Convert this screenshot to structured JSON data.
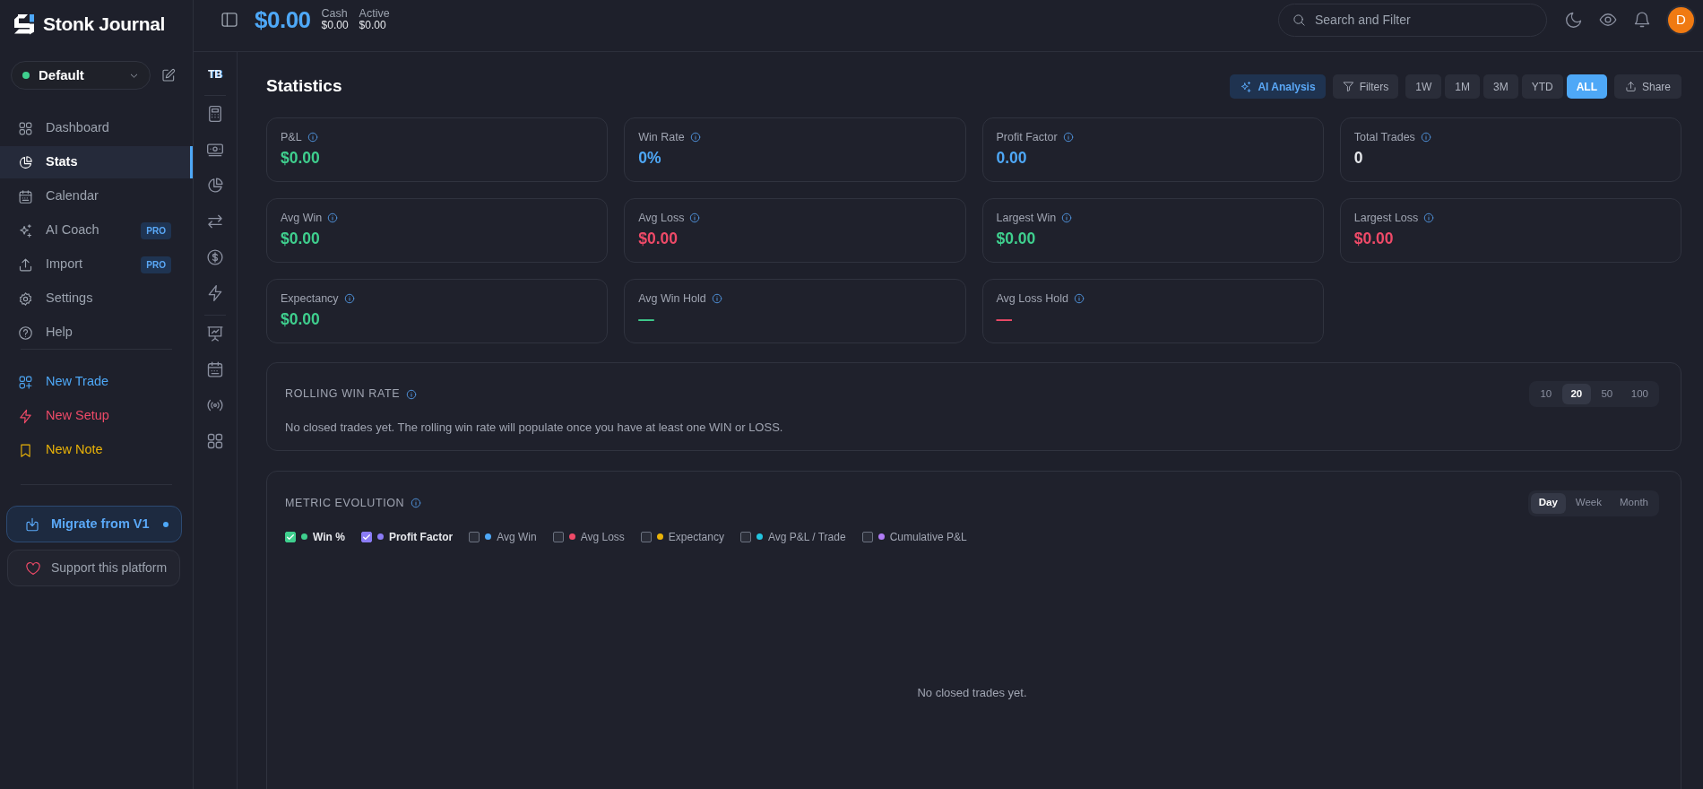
{
  "sidebar": {
    "brand": "Stonk Journal",
    "profile": {
      "name": "Default"
    },
    "nav": [
      {
        "label": "Dashboard",
        "selected": false
      },
      {
        "label": "Stats",
        "selected": true
      },
      {
        "label": "Calendar",
        "selected": false
      },
      {
        "label": "AI Coach",
        "selected": false,
        "badge": "PRO"
      },
      {
        "label": "Import",
        "selected": false,
        "badge": "PRO"
      },
      {
        "label": "Settings",
        "selected": false
      },
      {
        "label": "Help",
        "selected": false
      }
    ],
    "actions": [
      {
        "label": "New Trade",
        "color": "#4ea8f7"
      },
      {
        "label": "New Setup",
        "color": "#ef4a68"
      },
      {
        "label": "New Note",
        "color": "#eab308"
      }
    ],
    "migrate_button": "Migrate from V1",
    "support_button": "Support this platform"
  },
  "rail": {
    "initials": "TB"
  },
  "top_bar": {
    "balance": "$0.00",
    "accounts": [
      {
        "label": "Cash",
        "value": "$0.00"
      },
      {
        "label": "Active",
        "value": "$0.00"
      }
    ],
    "search": {
      "placeholder": "Search and Filter"
    },
    "avatar": {
      "initial": "D"
    }
  },
  "page": {
    "title": "Statistics",
    "ai_button": "AI Analysis",
    "filters_button": "Filters",
    "ranges": [
      {
        "label": "1W",
        "selected": false
      },
      {
        "label": "1M",
        "selected": false
      },
      {
        "label": "3M",
        "selected": false
      },
      {
        "label": "YTD",
        "selected": false
      },
      {
        "label": "ALL",
        "selected": true
      }
    ],
    "share_button": "Share"
  },
  "metrics": [
    {
      "label": "P&L",
      "value": "$0.00",
      "color": "#3fcf8e"
    },
    {
      "label": "Win Rate",
      "value": "0%",
      "color": "#4ea8f7"
    },
    {
      "label": "Profit Factor",
      "value": "0.00",
      "color": "#4ea8f7"
    },
    {
      "label": "Total Trades",
      "value": "0",
      "color": "#e5e7eb"
    },
    {
      "label": "Avg Win",
      "value": "$0.00",
      "color": "#3fcf8e"
    },
    {
      "label": "Avg Loss",
      "value": "$0.00",
      "color": "#ef4a68"
    },
    {
      "label": "Largest Win",
      "value": "$0.00",
      "color": "#3fcf8e"
    },
    {
      "label": "Largest Loss",
      "value": "$0.00",
      "color": "#ef4a68"
    },
    {
      "label": "Expectancy",
      "value": "$0.00",
      "color": "#3fcf8e"
    },
    {
      "label": "Avg Win Hold",
      "value": "—",
      "color": "#3fcf8e"
    },
    {
      "label": "Avg Loss Hold",
      "value": "—",
      "color": "#ef4a68"
    }
  ],
  "rolling_win_rate": {
    "title": "ROLLING WIN RATE",
    "windows": [
      {
        "label": "10",
        "selected": false
      },
      {
        "label": "20",
        "selected": true
      },
      {
        "label": "50",
        "selected": false
      },
      {
        "label": "100",
        "selected": false
      }
    ],
    "message": "No closed trades yet. The rolling win rate will populate once you have at least one WIN or LOSS."
  },
  "metric_evolution": {
    "title": "METRIC EVOLUTION",
    "periods": [
      {
        "label": "Day",
        "selected": true
      },
      {
        "label": "Week",
        "selected": false
      },
      {
        "label": "Month",
        "selected": false
      }
    ],
    "series": [
      {
        "label": "Win %",
        "checked": true,
        "color": "#3fcf8e"
      },
      {
        "label": "Profit Factor",
        "checked": true,
        "color": "#8b7cf6"
      },
      {
        "label": "Avg Win",
        "checked": false,
        "color": "#4ea8f7"
      },
      {
        "label": "Avg Loss",
        "checked": false,
        "color": "#ef4a68"
      },
      {
        "label": "Expectancy",
        "checked": false,
        "color": "#eab308"
      },
      {
        "label": "Avg P&L / Trade",
        "checked": false,
        "color": "#22c5e0"
      },
      {
        "label": "Cumulative P&L",
        "checked": false,
        "color": "#b07cf6"
      }
    ],
    "empty_message": "No closed trades yet."
  }
}
